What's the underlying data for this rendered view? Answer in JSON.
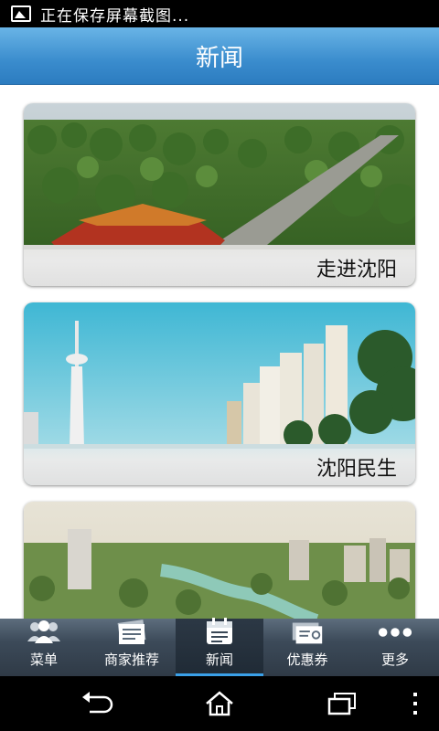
{
  "status_bar": {
    "notification_text": "正在保存屏幕截图..."
  },
  "header": {
    "title": "新闻"
  },
  "cards": [
    {
      "caption": "走进沈阳"
    },
    {
      "caption": "沈阳民生"
    },
    {
      "caption": ""
    }
  ],
  "tabs": [
    {
      "label": "菜单",
      "icon": "people-icon"
    },
    {
      "label": "商家推荐",
      "icon": "documents-icon"
    },
    {
      "label": "新闻",
      "icon": "calendar-icon",
      "active": true
    },
    {
      "label": "优惠券",
      "icon": "coupon-icon"
    },
    {
      "label": "更多",
      "icon": "more-dots-icon"
    }
  ],
  "colors": {
    "header": "#3a8ccd",
    "tab_active_indicator": "#3aa0e8",
    "tabbar": "#3c4a59"
  }
}
